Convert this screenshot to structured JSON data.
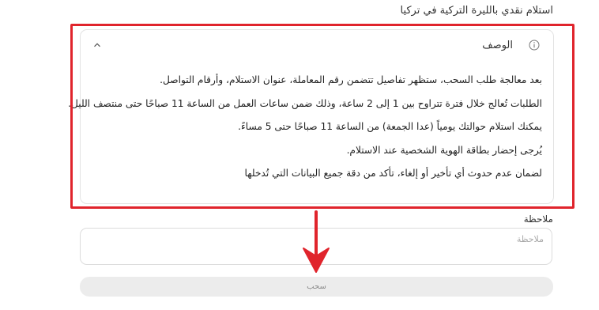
{
  "page": {
    "section_title": "استلام نقدي بالليرة التركية في تركيا"
  },
  "description": {
    "title": "الوصف",
    "lines": [
      "بعد معالجة طلب السحب، ستظهر تفاصيل تتضمن رقم المعاملة، عنوان الاستلام، وأرقام التواصل.",
      "الطلبات تُعالج خلال فترة تتراوح بين 1 إلى 2 ساعة، وذلك ضمن ساعات العمل من الساعة 11 صباحًا حتى منتصف الليل.",
      "يمكنك استلام حوالتك يومياً (عدا الجمعة) من الساعة 11 صباحًا حتى 5 مساءً.",
      "يُرجى إحضار بطاقة الهوية الشخصية عند الاستلام.",
      "لضمان عدم حدوث أي تأخير أو إلغاء، تأكد من دقة جميع البيانات التي تُدخلها"
    ]
  },
  "note": {
    "label": "ملاحظة",
    "value": "",
    "placeholder": "ملاحظة"
  },
  "submit": {
    "label": "سحب"
  },
  "annotation": {
    "frame_color": "#e0242c",
    "arrow_color": "#e0242c"
  },
  "icons": {
    "info": "info-icon",
    "chevron": "chevron-up-icon"
  }
}
